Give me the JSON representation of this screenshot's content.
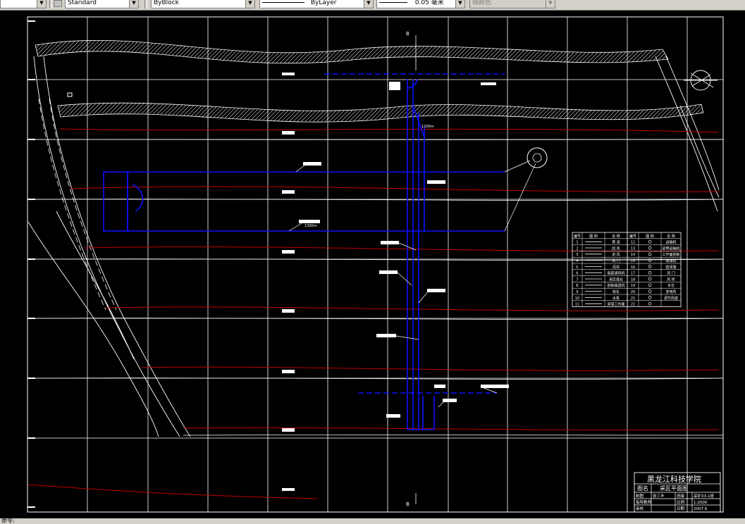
{
  "toolbar": {
    "text_style": "Standard",
    "layer_color": "ByBlock",
    "linetype": "ByLayer",
    "lineweight": "0.05 毫米",
    "plot_style": "随颜色"
  },
  "drawing": {
    "section_marker_top": "B",
    "section_marker_bottom": "B",
    "length_label_1": "1200m",
    "length_label_2": "1300m"
  },
  "legend": {
    "headers": [
      "编号",
      "图 例",
      "名 称",
      "编号",
      "图 例",
      "名 称"
    ],
    "rows": [
      [
        "1",
        "",
        "巷 道",
        "12",
        "",
        "运输机"
      ],
      [
        "2",
        "",
        "回 风",
        "13",
        "",
        "皮带运输机"
      ],
      [
        "3",
        "",
        "进 风",
        "14",
        "",
        "工作面刮板"
      ],
      [
        "4",
        "",
        "风 门",
        "15",
        "",
        "采煤机"
      ],
      [
        "5",
        "",
        "风帘",
        "16",
        "",
        "密闭墙"
      ],
      [
        "6",
        "",
        "局部通风机",
        "17",
        "",
        "风 门"
      ],
      [
        "7",
        "",
        "采区煤仓",
        "18",
        "",
        "风 桥"
      ],
      [
        "8",
        "",
        "刮板输送机",
        "19",
        "",
        "水仓"
      ],
      [
        "9",
        "",
        "绞车",
        "20",
        "",
        "变电所"
      ],
      [
        "10",
        "",
        "水泵",
        "21",
        "",
        "调节风窗"
      ],
      [
        "11",
        "",
        "采煤工作面",
        "22",
        "",
        ""
      ]
    ]
  },
  "title_block": {
    "school": "黑龙江科技学院",
    "name_label": "图名",
    "drawing_name": "采区平面图",
    "row1": [
      "制图",
      "张三丰",
      "班级",
      "采矿03-1班"
    ],
    "row2": [
      "指导教师",
      "",
      "比例",
      "1:2000"
    ],
    "row3": [
      "审核",
      "",
      "日期",
      "2007.6"
    ]
  },
  "status": {
    "text": "命令: "
  }
}
